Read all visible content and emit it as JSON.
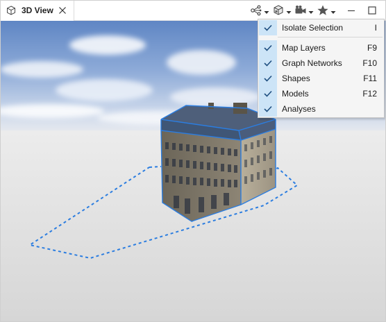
{
  "tab": {
    "title": "3D View",
    "icon": "cube-outline-icon",
    "close_icon": "close-icon"
  },
  "toolbar": {
    "items": [
      {
        "icon": "graph-network-icon",
        "has_dropdown": true
      },
      {
        "icon": "layers-cube-icon",
        "has_dropdown": true
      },
      {
        "icon": "camera-icon",
        "has_dropdown": true
      },
      {
        "icon": "star-icon",
        "has_dropdown": true
      }
    ],
    "minimize_icon": "minimize-icon",
    "maximize_icon": "maximize-icon"
  },
  "menu": {
    "items": [
      {
        "label": "Isolate Selection",
        "shortcut": "I",
        "checked": true
      },
      {
        "label": "Map Layers",
        "shortcut": "F9",
        "checked": true
      },
      {
        "label": "Graph Networks",
        "shortcut": "F10",
        "checked": true
      },
      {
        "label": "Shapes",
        "shortcut": "F11",
        "checked": true
      },
      {
        "label": "Models",
        "shortcut": "F12",
        "checked": true
      },
      {
        "label": "Analyses",
        "shortcut": "",
        "checked": true
      }
    ]
  },
  "colors": {
    "accent": "#2b7de0",
    "menu_check_bg": "#cce4f7",
    "menu_bg": "#f5f5f5",
    "sky_top": "#6d8fc8",
    "ground": "#d9d9d9"
  }
}
